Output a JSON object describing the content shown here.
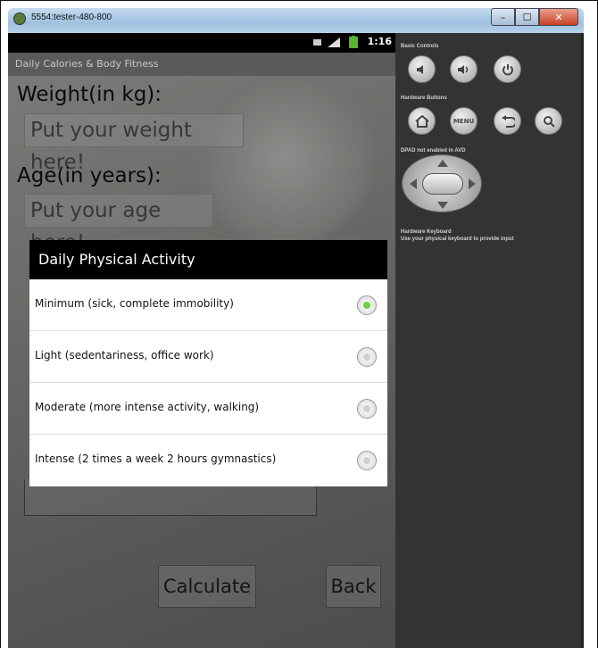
{
  "window": {
    "title": "5554:tester-480-800",
    "buttons": {
      "minimize": "–",
      "maximize": "☐",
      "close": "✕"
    }
  },
  "status_bar": {
    "time": "1:16"
  },
  "app": {
    "title": "Daily Calories & Body Fitness",
    "weight_label": "Weight(in kg):",
    "weight_placeholder": "Put your weight here!",
    "age_label": "Age(in years):",
    "age_placeholder": "Put your age here!",
    "calculate_label": "Calculate",
    "back_label": "Back"
  },
  "dialog": {
    "title": "Daily Physical Activity",
    "options": [
      {
        "label": "Minimum (sick, complete immobility)",
        "selected": true
      },
      {
        "label": "Light (sedentariness, office work)",
        "selected": false
      },
      {
        "label": "Moderate (more intense activity, walking)",
        "selected": false
      },
      {
        "label": "Intense (2 times a week 2 hours gymnastics)",
        "selected": false
      }
    ]
  },
  "emulator_panel": {
    "basic_controls_label": "Basic Controls",
    "hardware_buttons_label": "Hardware Buttons",
    "menu_label": "MENU",
    "dpad_label": "DPAD not enabled in AVD",
    "keyboard_label": "Hardware Keyboard",
    "keyboard_hint": "Use your physical keyboard to provide input"
  },
  "colors": {
    "selected_radio": "#6dd13b",
    "dialog_header": "#000000",
    "emulator_bg": "#333333"
  }
}
